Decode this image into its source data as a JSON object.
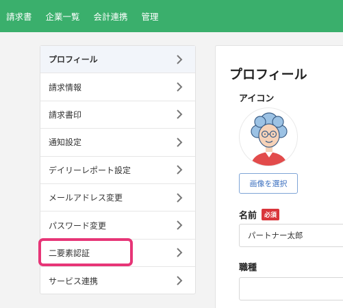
{
  "topnav": {
    "items": [
      {
        "label": "請求書"
      },
      {
        "label": "企業一覧"
      },
      {
        "label": "会計連携"
      },
      {
        "label": "管理"
      }
    ]
  },
  "sidebar": {
    "items": [
      {
        "label": "プロフィール",
        "active": true
      },
      {
        "label": "請求情報"
      },
      {
        "label": "請求書印"
      },
      {
        "label": "通知設定"
      },
      {
        "label": "デイリーレポート設定"
      },
      {
        "label": "メールアドレス変更"
      },
      {
        "label": "パスワード変更"
      },
      {
        "label": "二要素認証",
        "highlighted": true
      },
      {
        "label": "サービス連携"
      }
    ]
  },
  "profile": {
    "title": "プロフィール",
    "icon_label": "アイコン",
    "select_image_button": "画像を選択",
    "name_label": "名前",
    "required_badge": "必須",
    "name_value": "パートナー太郎",
    "job_label": "職種",
    "job_value": ""
  },
  "colors": {
    "nav_bg": "#3aaf6c",
    "highlight": "#e73577",
    "badge": "#d9353b",
    "button_text": "#3b6fbf"
  }
}
